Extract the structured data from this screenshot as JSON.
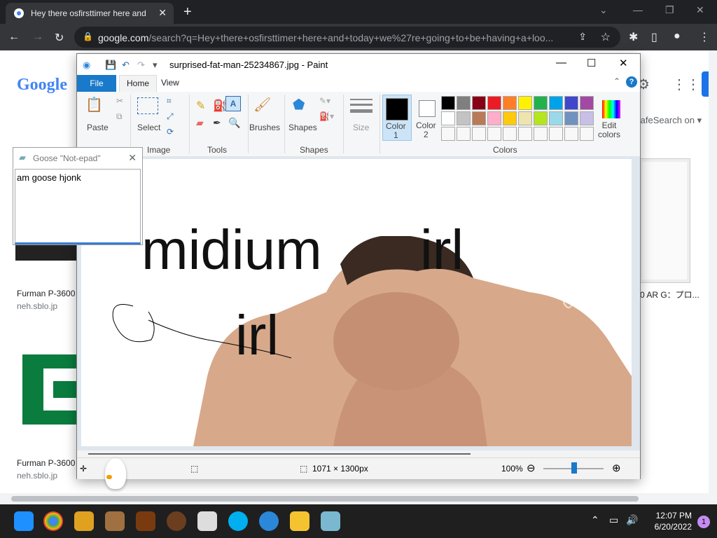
{
  "browser": {
    "tab_title": "Hey there osfirsttimer here and t",
    "url_domain": "google.com",
    "url_path": "/search?q=Hey+there+osfirsttimer+here+and+today+we%27re+going+to+be+having+a+loo..."
  },
  "google": {
    "logo": "Google",
    "safesearch": "SafeSearch on ▾",
    "results": [
      {
        "title": "Furman P-3600",
        "source": "neh.sblo.jp"
      },
      {
        "title": "Furman P-3600",
        "source": "neh.sblo.jp"
      },
      {
        "title": "0 AR G：プロ..."
      }
    ]
  },
  "paint": {
    "title": "surprised-fat-man-25234867.jpg - Paint",
    "tabs": [
      "File",
      "Home",
      "View"
    ],
    "groups": {
      "image": "Image",
      "tools": "Tools",
      "shapes": "Shapes",
      "colors": "Colors"
    },
    "buttons": {
      "paste": "Paste",
      "select": "Select",
      "brushes": "Brushes",
      "shapes": "Shapes",
      "size": "Size",
      "color1": "Color\n1",
      "color2": "Color\n2",
      "edit_colors": "Edit\ncolors"
    },
    "palette_row1": [
      "#000000",
      "#7f7f7f",
      "#880015",
      "#ed1c24",
      "#ff7f27",
      "#fff200",
      "#22b14c",
      "#00a2e8",
      "#3f48cc",
      "#a349a4"
    ],
    "palette_row2": [
      "#ffffff",
      "#c3c3c3",
      "#b97a57",
      "#ffaec9",
      "#ffc90e",
      "#efe4b0",
      "#b5e61d",
      "#99d9ea",
      "#7092be",
      "#c8bfe7"
    ],
    "canvas_text": {
      "midium": "midium",
      "irl_top": "irl",
      "irl_bottom": "irl",
      "watermark": "dream"
    },
    "status": {
      "dimensions": "1071 × 1300px",
      "zoom": "100%"
    }
  },
  "goose": {
    "title": "Goose \"Not-epad\"",
    "text": "am goose hjonk"
  },
  "taskbar": {
    "time": "12:07 PM",
    "date": "6/20/2022",
    "notifications": "1"
  }
}
